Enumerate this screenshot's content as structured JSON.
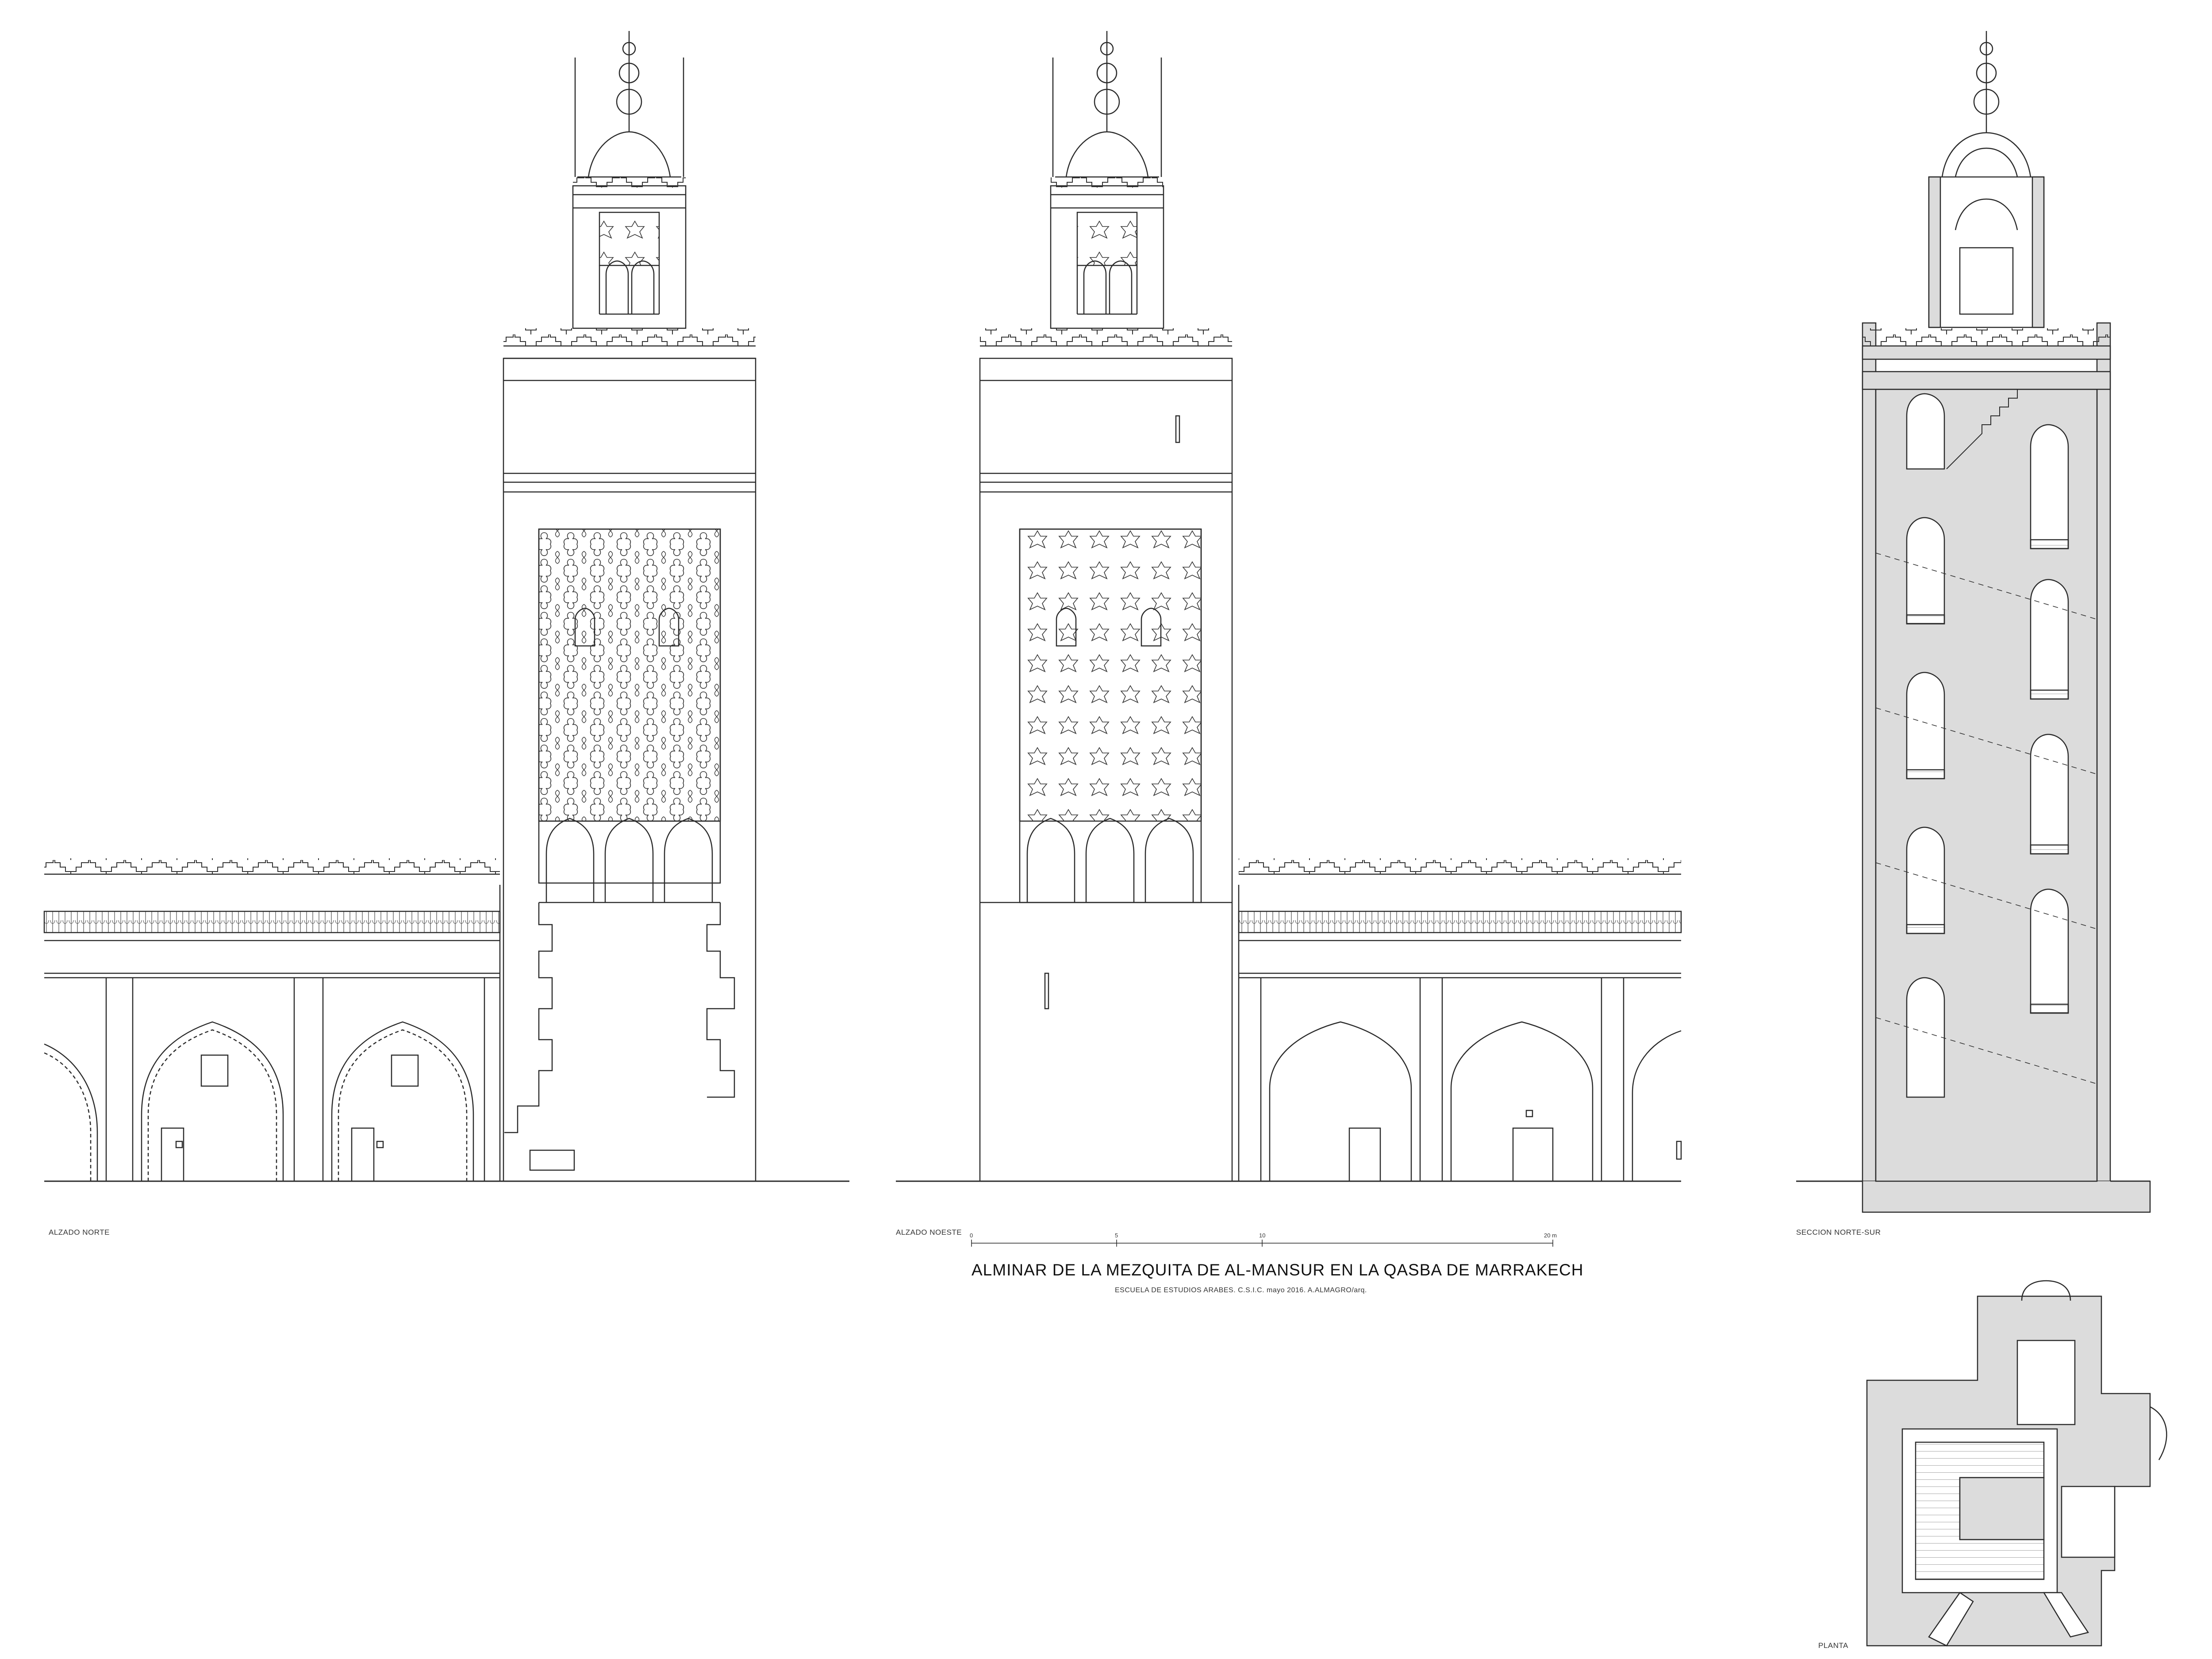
{
  "sheet": {
    "title": "ALMINAR DE LA MEZQUITA DE AL-MANSUR EN LA QASBA DE MARRAKECH",
    "subtitle": "ESCUELA DE ESTUDIOS ARABES. C.S.I.C.    mayo 2016.    A.ALMAGRO/arq."
  },
  "views": {
    "north_elevation": "ALZADO NORTE",
    "northwest_elevation": "ALZADO NOESTE",
    "section": "SECCION NORTE-SUR",
    "plan": "PLANTA"
  },
  "scale_bar": {
    "ticks": [
      "0",
      "5",
      "10",
      "20 m"
    ]
  },
  "colors": {
    "line": "#2b2b2b",
    "hatch": "#d9d9d9",
    "background": "#ffffff"
  }
}
